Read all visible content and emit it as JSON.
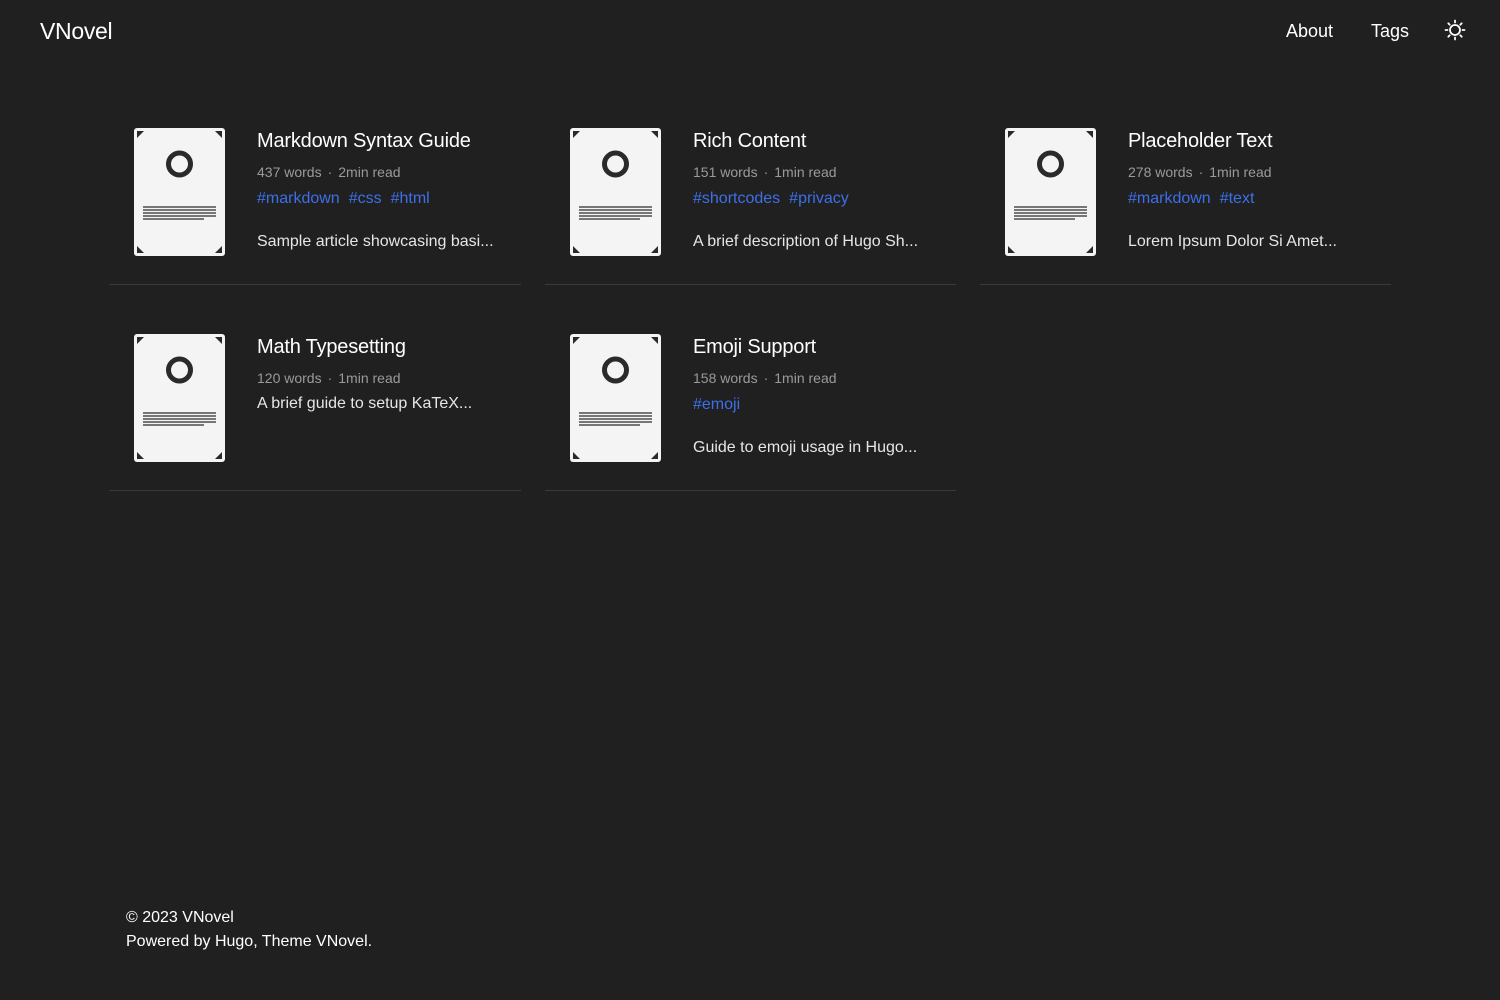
{
  "header": {
    "brand": "VNovel",
    "nav": [
      {
        "label": "About"
      },
      {
        "label": "Tags"
      }
    ],
    "theme_icon": "sun-icon"
  },
  "colors": {
    "background": "#202020",
    "tag_link": "#3d6fe9",
    "meta_text": "#9a9a9a",
    "thumbnail": "#f4f4f4"
  },
  "posts": [
    {
      "title": "Markdown Syntax Guide",
      "words": "437 words",
      "read": "2min read",
      "tags": [
        "#markdown",
        "#css",
        "#html"
      ],
      "description": "Sample article showcasing basi..."
    },
    {
      "title": "Rich Content",
      "words": "151 words",
      "read": "1min read",
      "tags": [
        "#shortcodes",
        "#privacy"
      ],
      "description": "A brief description of Hugo Sh..."
    },
    {
      "title": "Placeholder Text",
      "words": "278 words",
      "read": "1min read",
      "tags": [
        "#markdown",
        "#text"
      ],
      "description": "Lorem Ipsum Dolor Si Amet..."
    },
    {
      "title": "Math Typesetting",
      "words": "120 words",
      "read": "1min read",
      "tags": [],
      "description": "A brief guide to setup KaTeX..."
    },
    {
      "title": "Emoji Support",
      "words": "158 words",
      "read": "1min read",
      "tags": [
        "#emoji"
      ],
      "description": "Guide to emoji usage in Hugo..."
    }
  ],
  "meta_separator": "·",
  "footer": {
    "copyright": "© 2023 VNovel",
    "powered_prefix": "Powered by ",
    "hugo": "Hugo",
    "comma": ", ",
    "theme": "Theme VNovel",
    "period": "."
  }
}
